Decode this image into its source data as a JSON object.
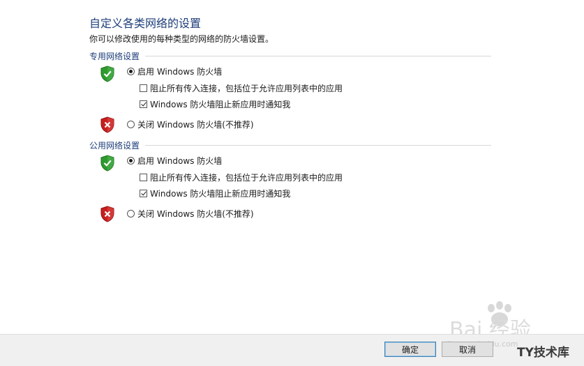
{
  "page": {
    "title": "自定义各类网络的设置",
    "description": "你可以修改使用的每种类型的网络的防火墙设置。"
  },
  "private_network": {
    "header": "专用网络设置",
    "enable_label": "启用 Windows 防火墙",
    "block_all_label": "阻止所有传入连接，包括位于允许应用列表中的应用",
    "notify_label": "Windows 防火墙阻止新应用时通知我",
    "disable_label": "关闭 Windows 防火墙(不推荐)",
    "enabled": true,
    "block_all": false,
    "notify": true
  },
  "public_network": {
    "header": "公用网络设置",
    "enable_label": "启用 Windows 防火墙",
    "block_all_label": "阻止所有传入连接，包括位于允许应用列表中的应用",
    "notify_label": "Windows 防火墙阻止新应用时通知我",
    "disable_label": "关闭 Windows 防火墙(不推荐)",
    "enabled": true,
    "block_all": false,
    "notify": true
  },
  "buttons": {
    "ok_label": "确定",
    "cancel_label": "取消"
  },
  "watermark": {
    "baidu_text": "Bai  经验",
    "url_text": "jingyan.baidu.com",
    "ty_text": "TY技术库"
  },
  "colors": {
    "title": "#1e3e7a",
    "shield_green": "#2e9a2e",
    "shield_red": "#c81e1e"
  },
  "icons": [
    "shield-check-icon",
    "shield-x-icon",
    "paw-icon"
  ]
}
